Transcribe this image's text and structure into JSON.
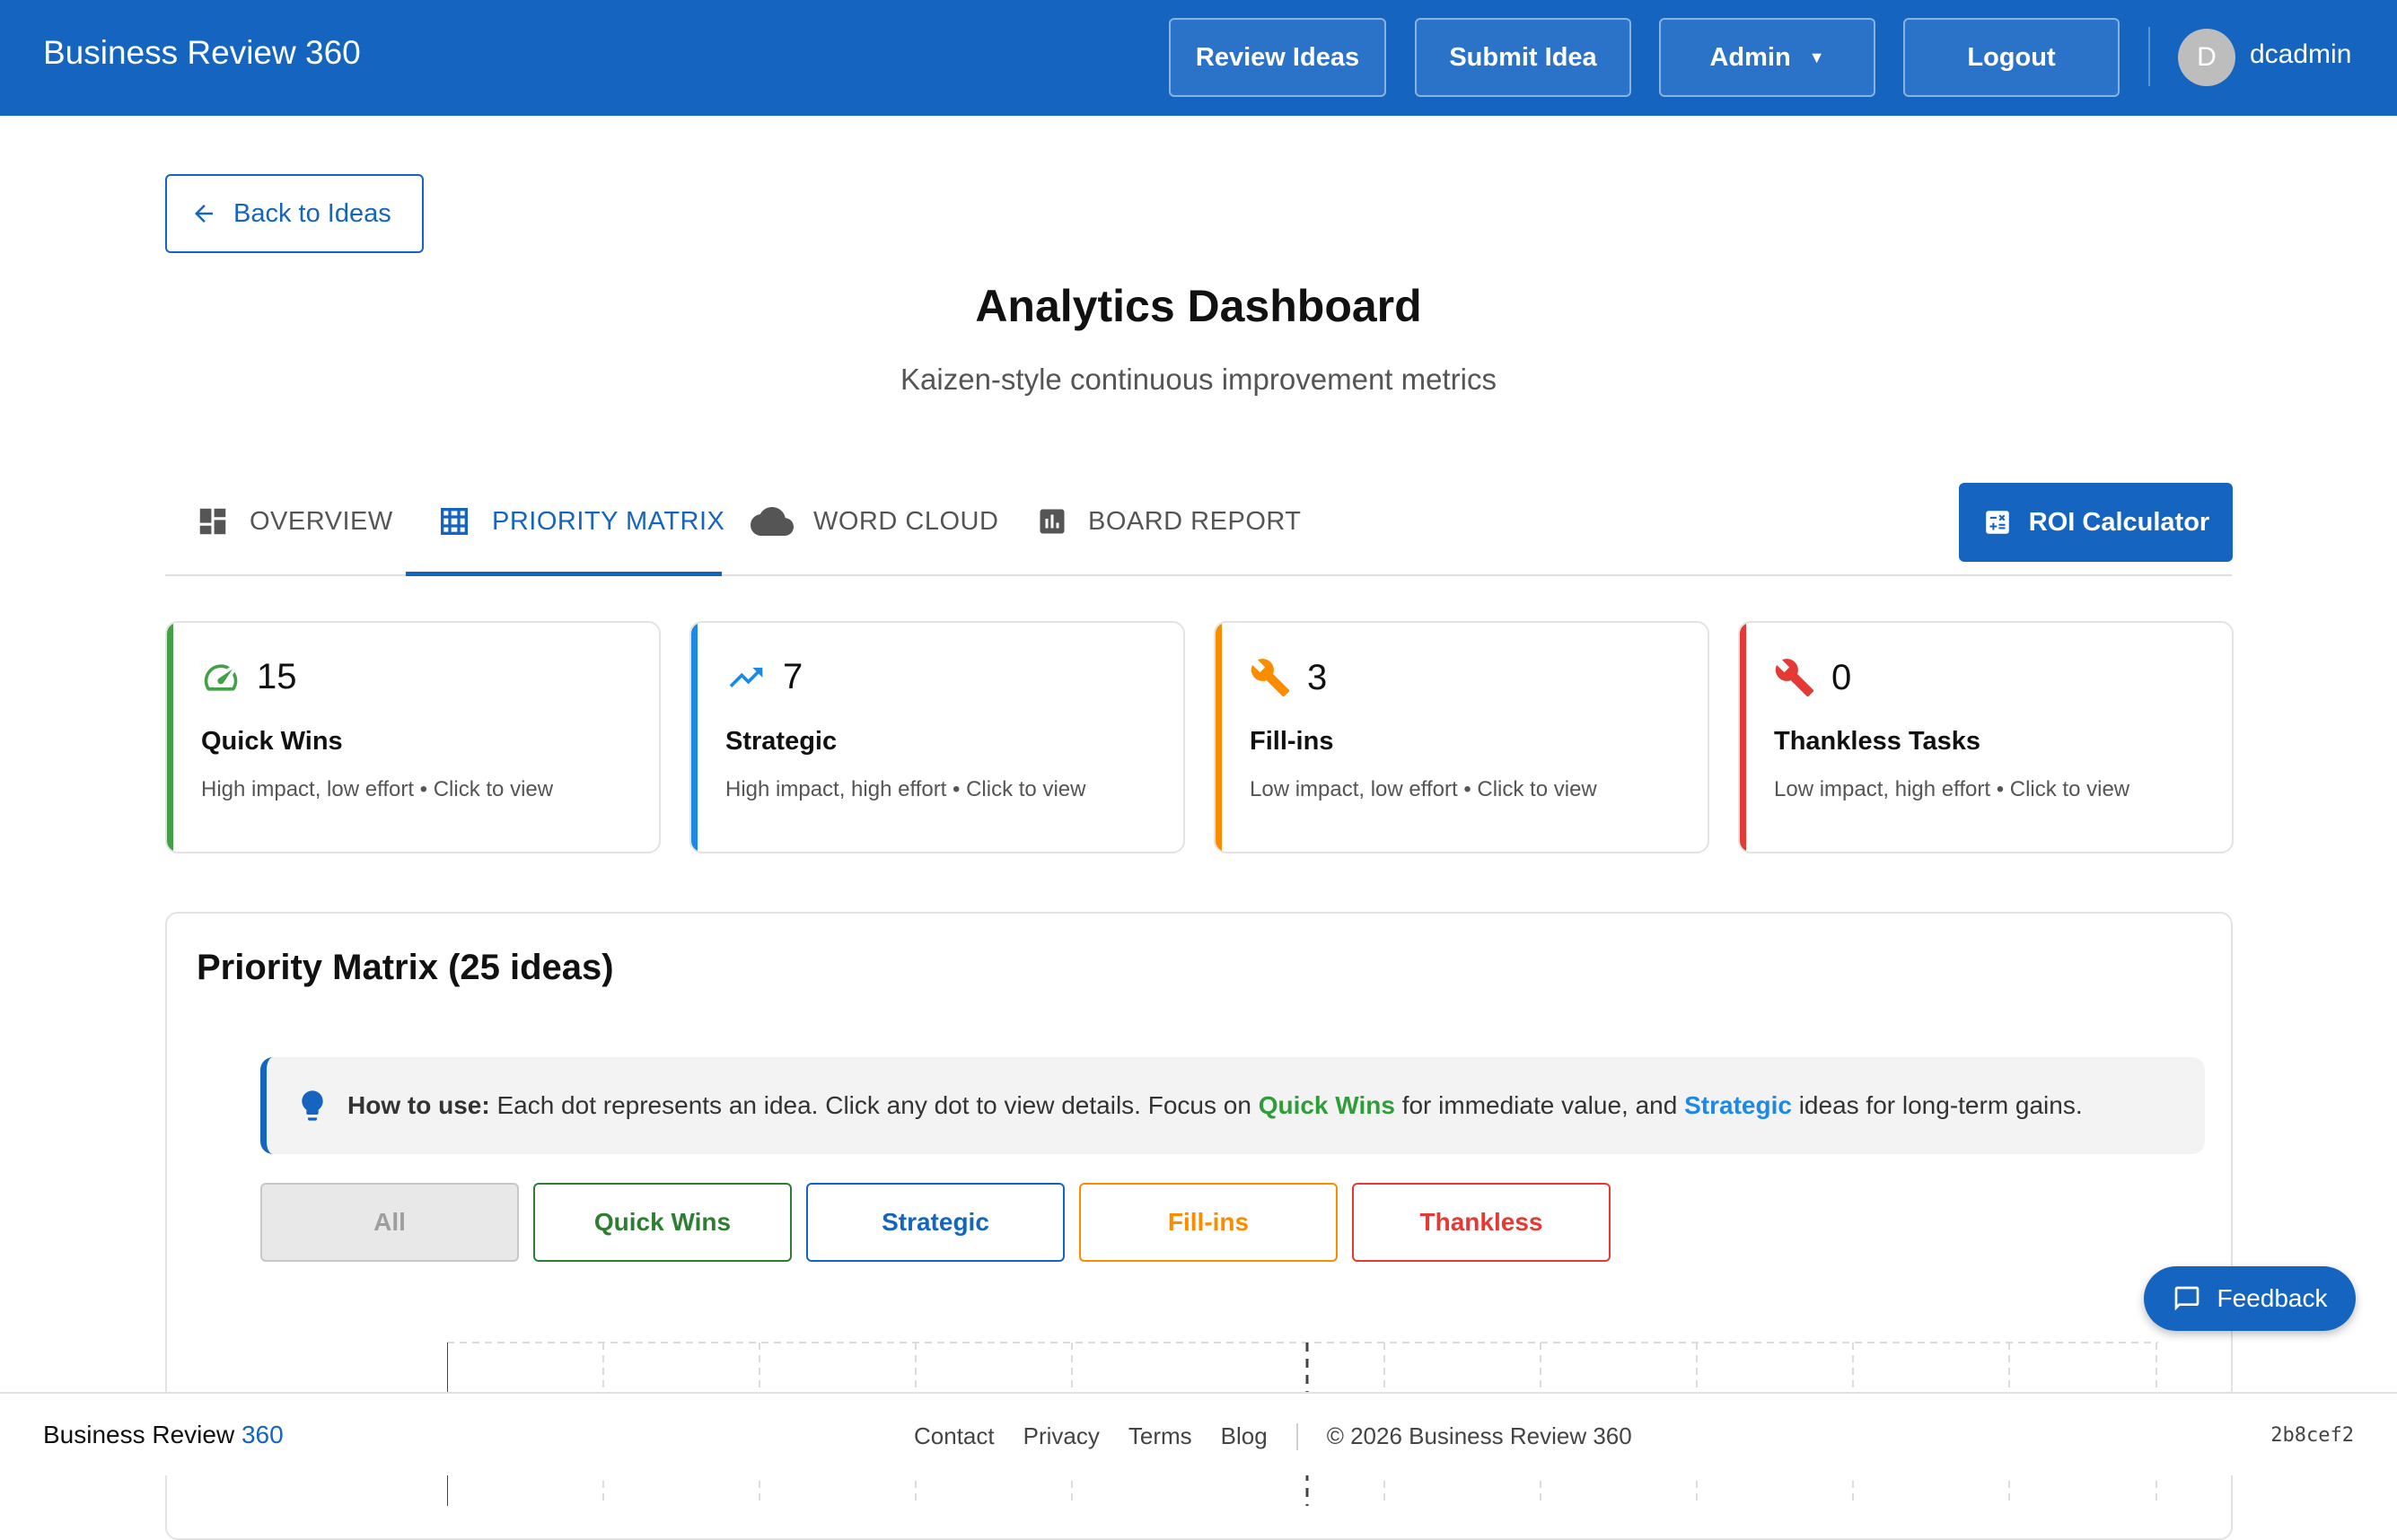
{
  "header": {
    "brand": "Business Review 360",
    "nav": [
      "Review Ideas",
      "Submit Idea",
      "Admin",
      "Logout"
    ],
    "avatar_initial": "D",
    "username": "dcadmin"
  },
  "back_label": "Back to Ideas",
  "page": {
    "title": "Analytics Dashboard",
    "subtitle": "Kaizen-style continuous improvement metrics"
  },
  "tabs": [
    {
      "label": "OVERVIEW",
      "icon": "dashboard-icon"
    },
    {
      "label": "PRIORITY MATRIX",
      "icon": "grid-icon",
      "active": true
    },
    {
      "label": "WORD CLOUD",
      "icon": "cloud-icon"
    },
    {
      "label": "BOARD REPORT",
      "icon": "bar-chart-icon"
    }
  ],
  "roi_label": "ROI Calculator",
  "cards": [
    {
      "value": "15",
      "label": "Quick Wins",
      "desc": "High impact, low effort • Click to view",
      "color": "#43a047",
      "icon": "speedometer-icon"
    },
    {
      "value": "7",
      "label": "Strategic",
      "desc": "High impact, high effort • Click to view",
      "color": "#1e88e5",
      "icon": "trending-up-icon"
    },
    {
      "value": "3",
      "label": "Fill-ins",
      "desc": "Low impact, low effort • Click to view",
      "color": "#fb8c00",
      "icon": "wrench-icon"
    },
    {
      "value": "0",
      "label": "Thankless Tasks",
      "desc": "Low impact, high effort • Click to view",
      "color": "#e53935",
      "icon": "wrench-icon"
    }
  ],
  "matrix": {
    "title": "Priority Matrix (25 ideas)",
    "howto": {
      "lead": "How to use:",
      "text1": "Each dot represents an idea. Click any dot to view details. Focus on",
      "quick_wins": "Quick Wins",
      "text2": "for immediate value, and",
      "strategic": "Strategic",
      "text3": "ideas for long-term gains."
    },
    "filters": [
      {
        "label": "All",
        "color": "#9e9e9e",
        "selected": true
      },
      {
        "label": "Quick Wins",
        "color": "#2e7d32"
      },
      {
        "label": "Strategic",
        "color": "#1565c0"
      },
      {
        "label": "Fill-ins",
        "color": "#fb8c00"
      },
      {
        "label": "Thankless",
        "color": "#e53935"
      }
    ]
  },
  "footer": {
    "brand_a": "Business Review",
    "brand_b": "360",
    "links": [
      "Contact",
      "Privacy",
      "Terms",
      "Blog"
    ],
    "copyright": "© 2026 Business Review 360",
    "hash": "2b8cef2"
  },
  "feedback_label": "Feedback"
}
